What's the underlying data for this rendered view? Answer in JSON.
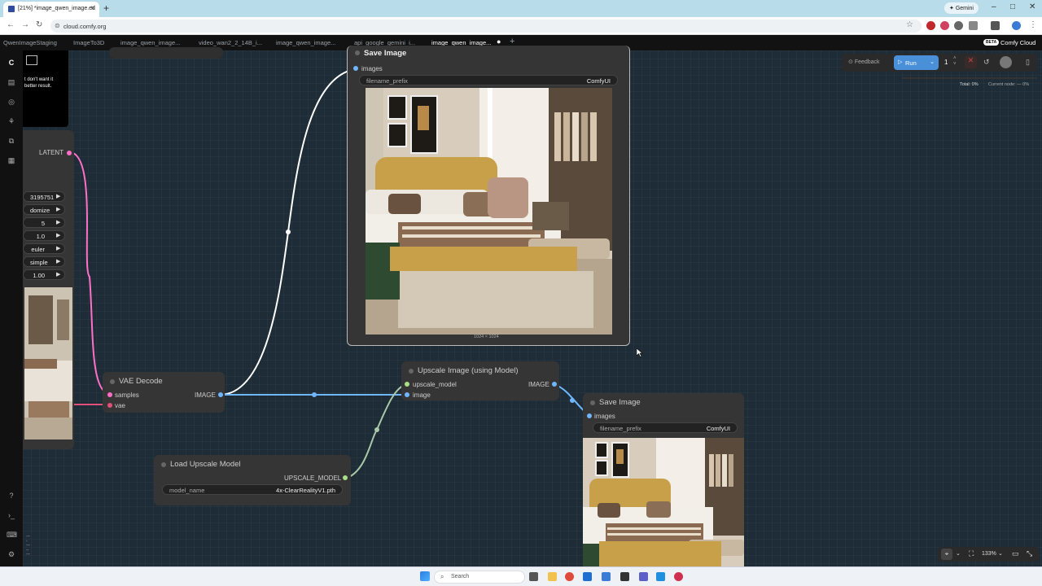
{
  "browser": {
    "active_tab_title": "[21%] *image_qwen_image.ed",
    "new_tab": "+",
    "url": "cloud.comfy.org",
    "gemini_label": "Gemini"
  },
  "app_tabs": [
    "QwenImageStaging",
    "ImageTo3D",
    "image_qwen_image...",
    "video_wan2_2_14B_i...",
    "image_qwen_image...",
    "api_google_gemini_i...",
    "image_qwen_image..."
  ],
  "app_brand": {
    "beta": "BETA",
    "name": "Comfy Cloud"
  },
  "toolbar": {
    "feedback": "Feedback",
    "run": "Run",
    "queue_count": "1",
    "total_progress": "Total: 0%",
    "node_progress": "Current node: — 0%"
  },
  "partial_note": {
    "line1": "t don't want it",
    "line2": "better result."
  },
  "sampler_values": [
    "3195751",
    "domize",
    "5",
    "1.0",
    "euler",
    "simple",
    "1.00"
  ],
  "latent_label": "LATENT",
  "save_image_1": {
    "title": "Save Image",
    "input": "images",
    "widget_label": "filename_prefix",
    "widget_value": "ComfyUI",
    "resolution": "1024 × 1024"
  },
  "vae_decode": {
    "title": "VAE Decode",
    "in1": "samples",
    "in2": "vae",
    "out": "IMAGE"
  },
  "upscale_node": {
    "title": "Upscale Image (using Model)",
    "in1": "upscale_model",
    "in2": "image",
    "out": "IMAGE"
  },
  "save_image_2": {
    "title": "Save Image",
    "input": "images",
    "widget_label": "filename_prefix",
    "widget_value": "ComfyUI"
  },
  "load_upscale": {
    "title": "Load Upscale Model",
    "out": "UPSCALE_MODEL",
    "widget_label": "model_name",
    "widget_value": "4x-ClearRealityV1.pth"
  },
  "zoom": "133%",
  "taskbar": {
    "search": "Search"
  },
  "colors": {
    "accent": "#4a90d9",
    "latent_link": "#ff6fc8",
    "image_link": "#6fb6ff",
    "model_link": "#a8c8a8",
    "canvas": "#1d2c36"
  }
}
